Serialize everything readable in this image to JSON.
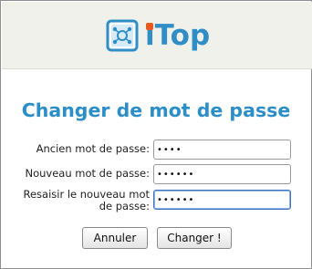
{
  "header": {
    "logo_text": "iTop",
    "logo_text_rest": "Top",
    "logo_text_first": "i"
  },
  "form": {
    "title": "Changer de mot de passe",
    "old_password": {
      "label": "Ancien mot de passe:",
      "value": "1234"
    },
    "new_password": {
      "label": "Nouveau mot de passe:",
      "value": "123456"
    },
    "confirm_password": {
      "label_line1": "Resaisir le nouveau mot",
      "label_line2": "de passe:",
      "value": "123456"
    }
  },
  "buttons": {
    "cancel_label": "Annuler",
    "submit_label": "Changer !"
  },
  "colors": {
    "accent": "#2b8ec8",
    "logo_dot": "#e95a1e",
    "header_bg": "#f1f1ec"
  }
}
